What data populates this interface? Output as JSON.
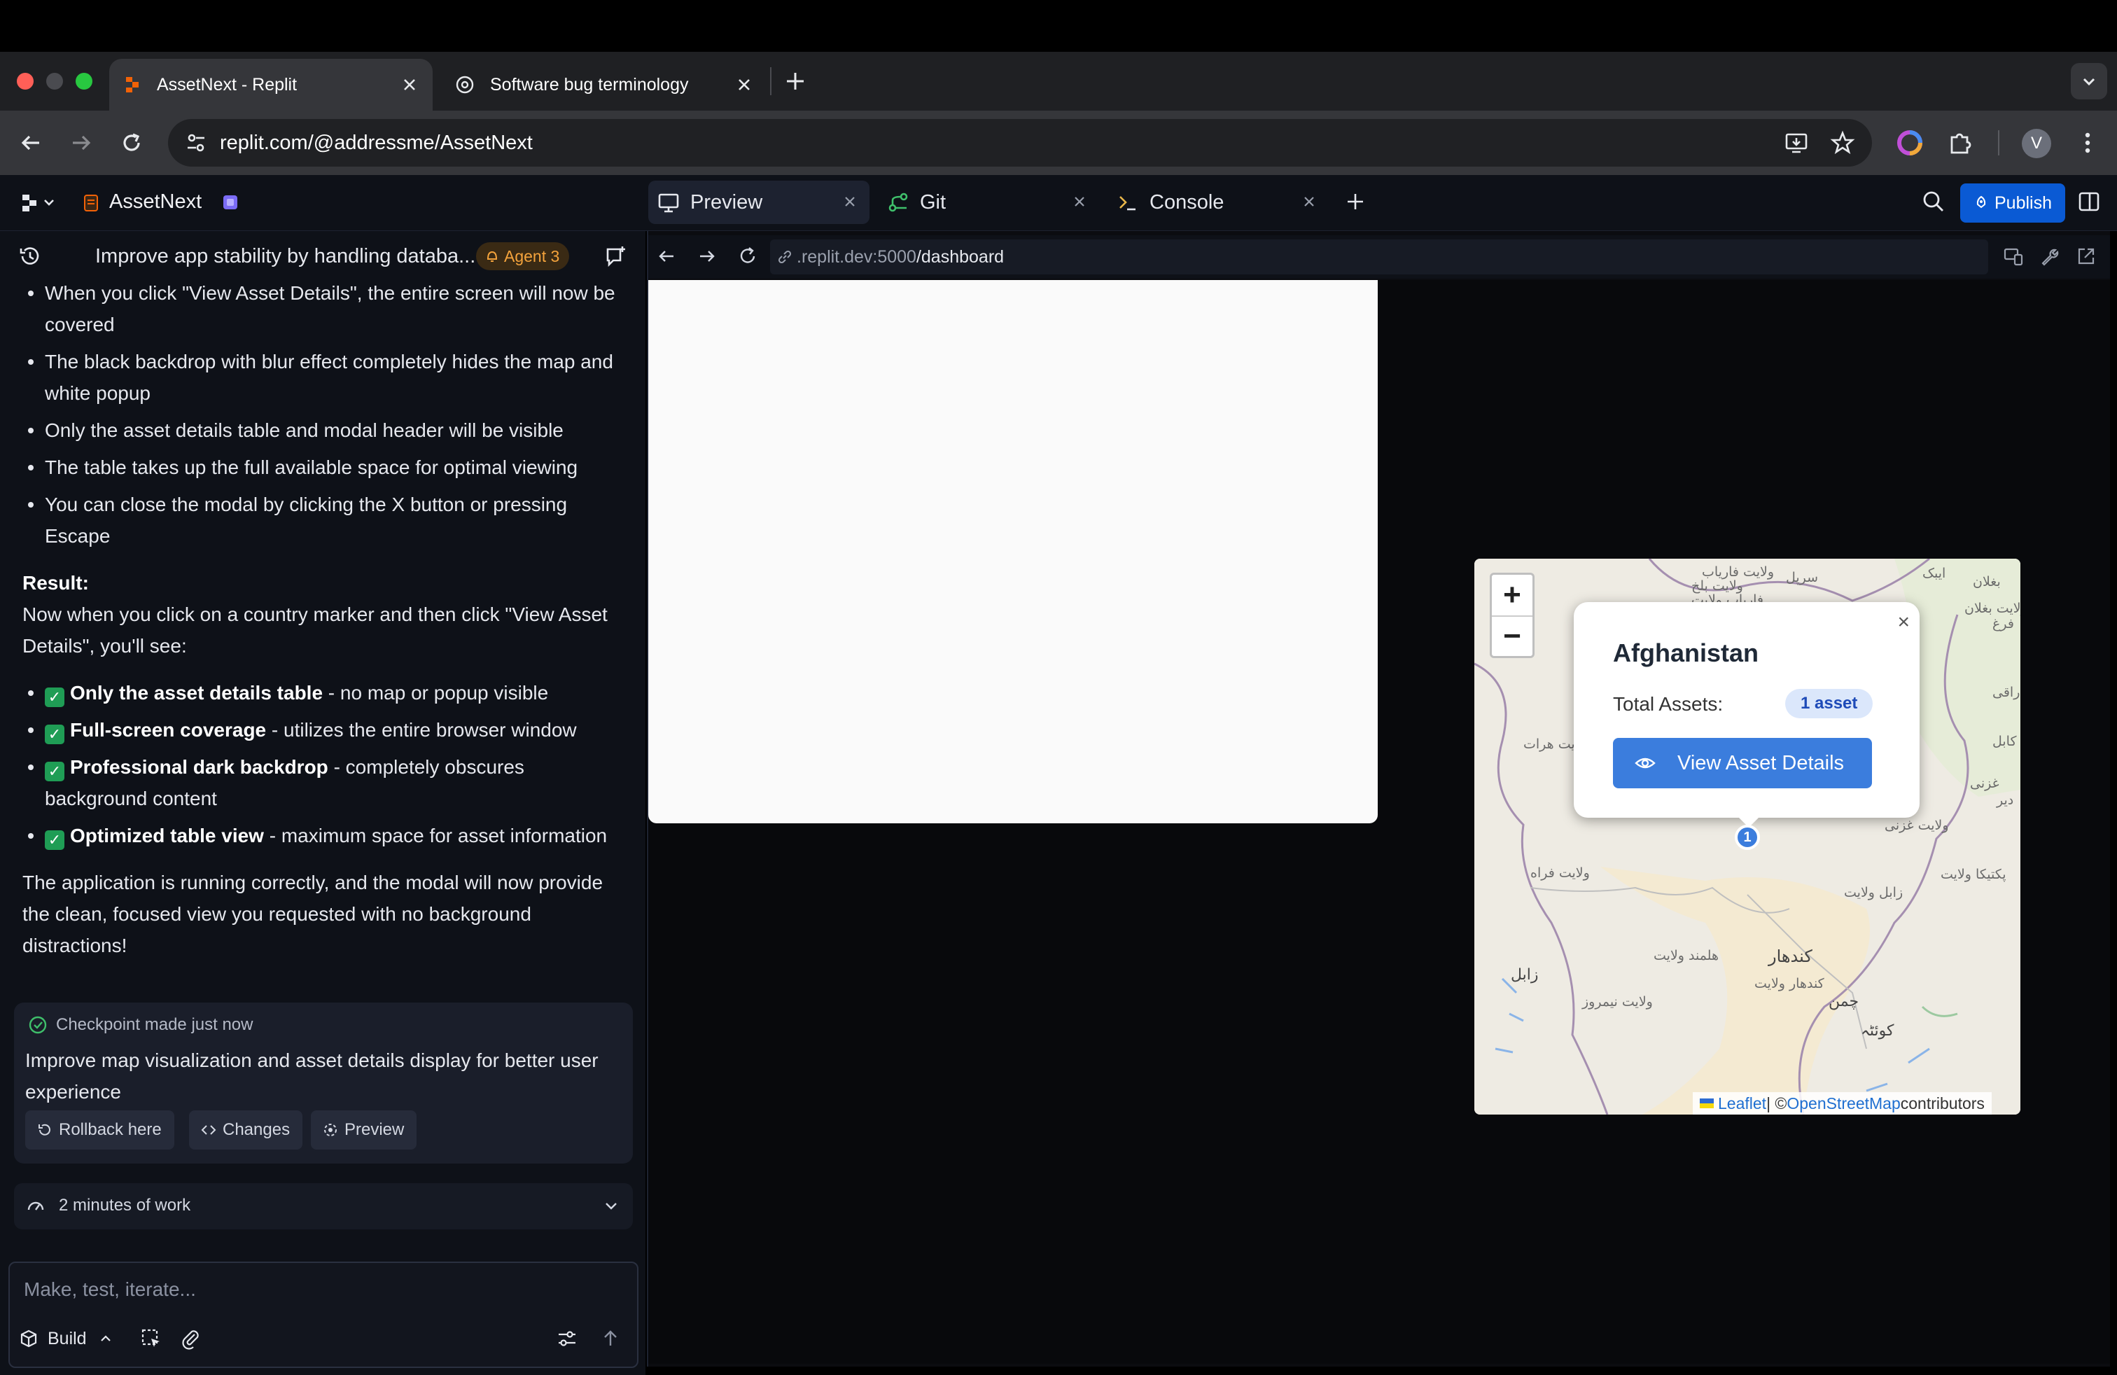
{
  "browser": {
    "tabs": [
      {
        "title": "AssetNext - Replit",
        "active": true
      },
      {
        "title": "Software bug terminology",
        "active": false
      }
    ],
    "address": "replit.com/@addressme/AssetNext",
    "profile_initial": "V"
  },
  "header": {
    "workspace_name": "AssetNext",
    "pane_tabs": [
      {
        "label": "Preview",
        "active": true
      },
      {
        "label": "Git",
        "active": false
      },
      {
        "label": "Console",
        "active": false
      }
    ],
    "publish_label": "Publish"
  },
  "chat": {
    "task_title": "Improve app stability by handling databa...",
    "agent_badge": "Agent 3",
    "bullets": [
      "When you click \"View Asset Details\", the entire screen will now be covered",
      "The black backdrop with blur effect completely hides the map and white popup",
      "Only the asset details table and modal header will be visible",
      "The table takes up the full available space for optimal viewing",
      "You can close the modal by clicking the X button or pressing Escape"
    ],
    "result_heading": "Result:",
    "result_text": "Now when you click on a country marker and then click \"View Asset Details\", you'll see:",
    "results": [
      {
        "bold": "Only the asset details table",
        "rest": " - no map or popup visible"
      },
      {
        "bold": "Full-screen coverage",
        "rest": " - utilizes the entire browser window"
      },
      {
        "bold": "Professional dark backdrop",
        "rest": " - completely obscures background content"
      },
      {
        "bold": "Optimized table view",
        "rest": " - maximum space for asset information"
      }
    ],
    "closing_text": "The application is running correctly, and the modal will now provide the clean, focused view you requested with no background distractions!",
    "checkpoint": {
      "label": "Checkpoint made just now",
      "text": "Improve map visualization and asset details display for better user experience",
      "buttons": [
        "Rollback here",
        "Changes",
        "Preview"
      ]
    },
    "work_label": "2 minutes of work",
    "composer_placeholder": "Make, test, iterate...",
    "build_label": "Build"
  },
  "preview": {
    "url_host": ".replit.dev:5000",
    "url_path": "/dashboard"
  },
  "map": {
    "popup": {
      "country": "Afghanistan",
      "total_label": "Total Assets:",
      "asset_count": "1 asset",
      "button_label": "View Asset Details",
      "close": "×"
    },
    "marker_count": "1",
    "zoom_in": "+",
    "zoom_out": "−",
    "attribution": {
      "leaflet": "Leaflet",
      "sep": " | © ",
      "osm": "OpenStreetMap",
      "tail": " contributors"
    },
    "place_labels": [
      "ولایت بلخ",
      "سرپل",
      "ولایت فاریاب",
      "فاریاب ولایت",
      "ایبک",
      "بغلان",
      "ولایت بغلان",
      "ولایت هرات",
      "ولایت فراه",
      "ولایت غزنی",
      "زابل ولایت",
      "پکتیکا ولایت",
      "هلمند ولایت",
      "کندهار",
      "کندهار ولایت",
      "ولایت نیمروز",
      "زابل",
      "چمن",
      "کوئٹہ",
      "غزنی",
      "کابل",
      "راقی",
      "دیر",
      "فرغ"
    ]
  },
  "colors": {
    "accent": "#0a5ad4",
    "marker": "#3b7ddd",
    "agent": "#f4a33c"
  }
}
